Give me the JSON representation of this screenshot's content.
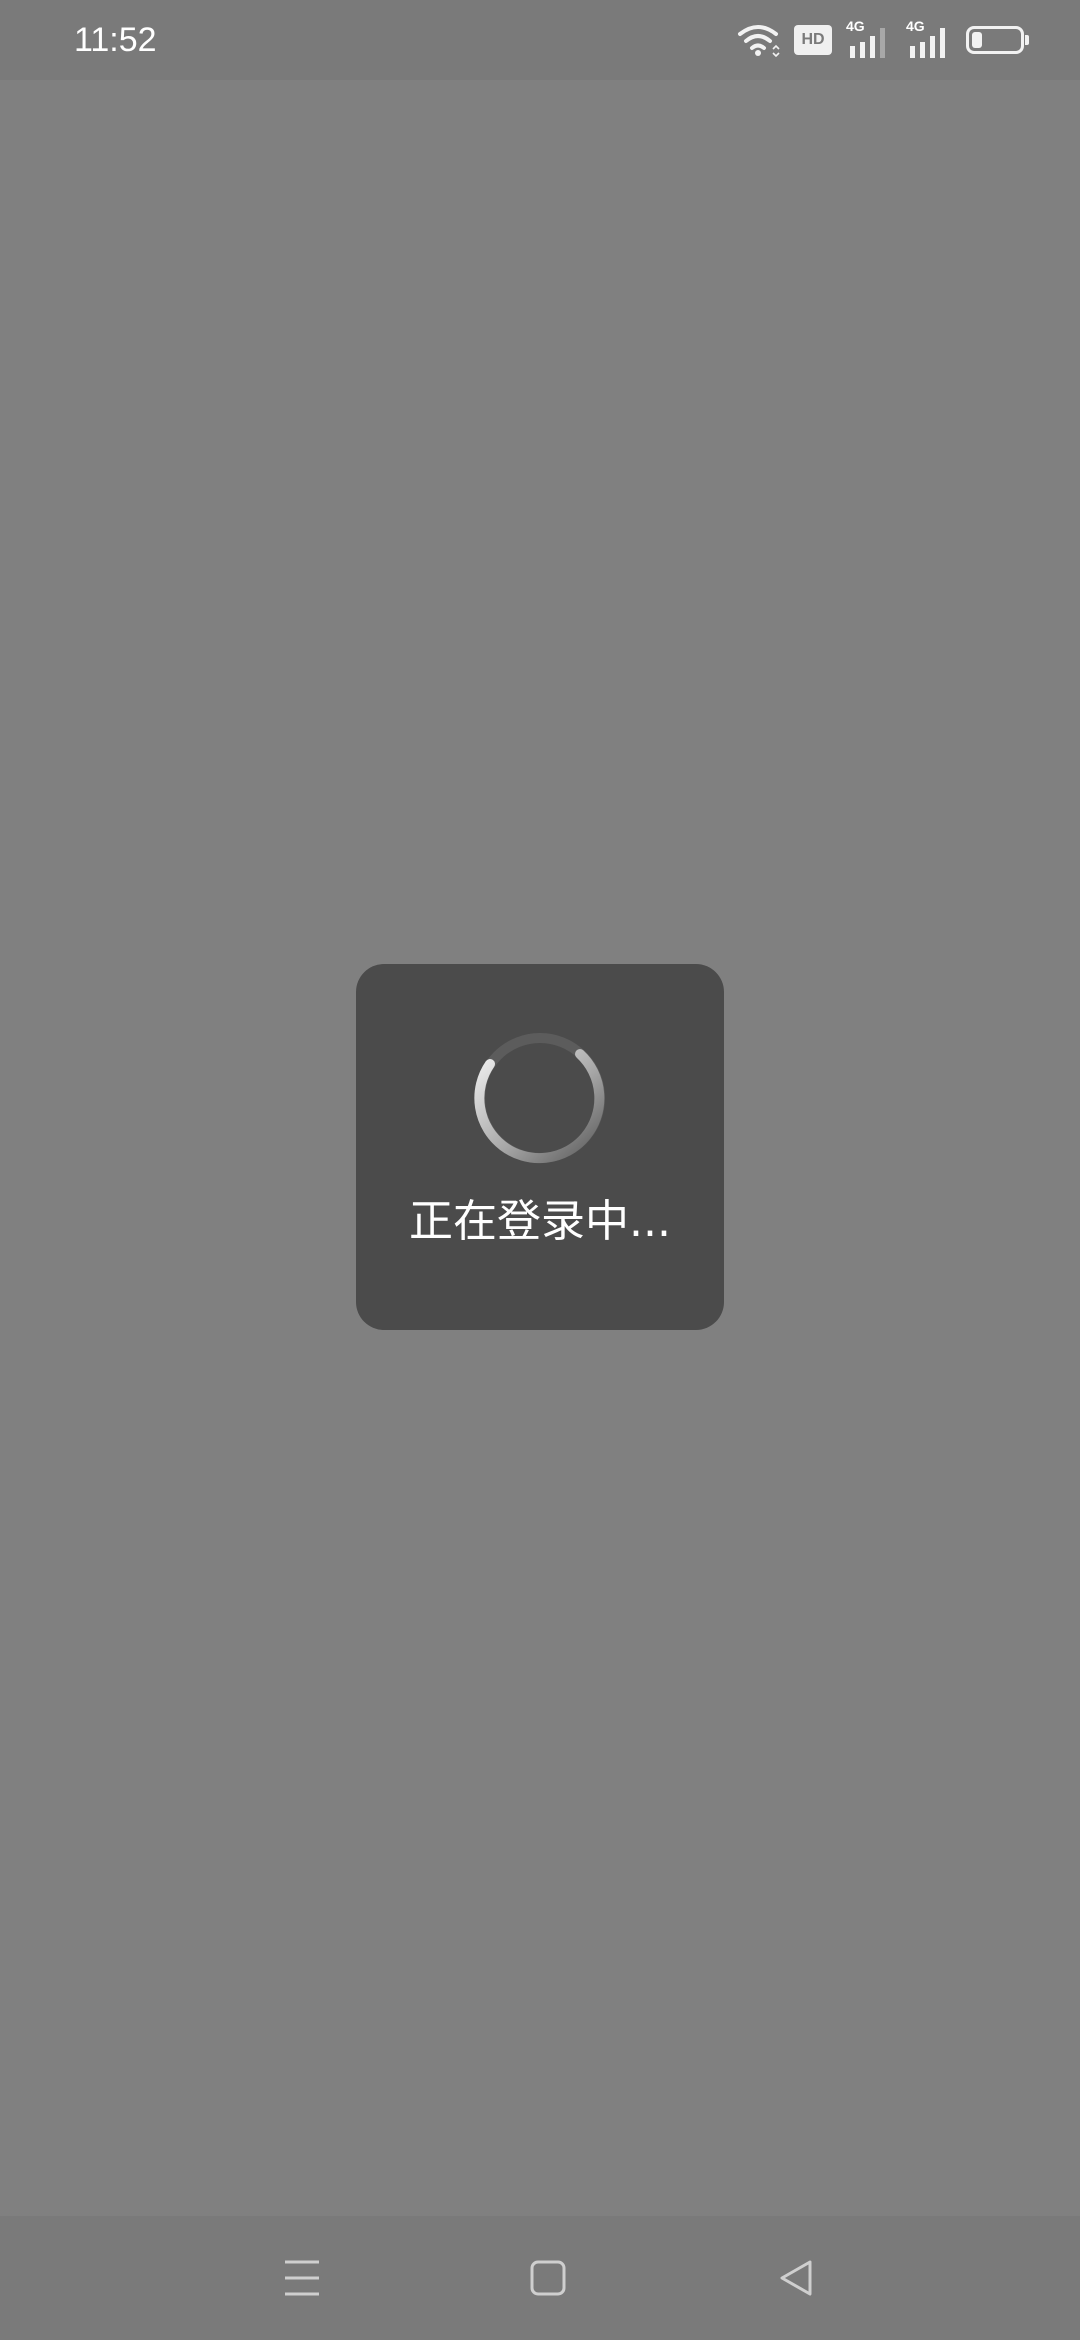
{
  "status_bar": {
    "time": "11:52",
    "hd_badge": "HD",
    "sim1_network": "4G",
    "sim2_network": "4G",
    "battery_level": 0.22,
    "icons": [
      "wifi-icon",
      "hd-voice-icon",
      "signal-sim1-icon",
      "signal-sim2-icon",
      "battery-icon"
    ]
  },
  "dialog": {
    "message": "正在登录中..."
  },
  "nav_bar": {
    "icons": [
      "recent-apps-icon",
      "home-icon",
      "back-icon"
    ]
  },
  "colors": {
    "background": "#808080",
    "status_bar": "#7a7a7a",
    "dialog": "#4b4b4b",
    "text": "#ffffff"
  }
}
